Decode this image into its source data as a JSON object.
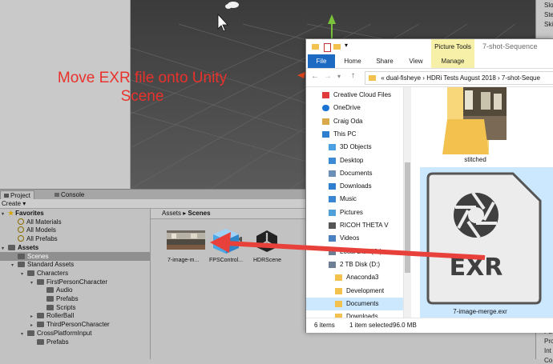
{
  "annotation": {
    "line1": "Move EXR file onto Unity",
    "line2": "Scene"
  },
  "inspector": {
    "items": [
      "Slo",
      "Ste",
      "Ski",
      "Ma",
      "Pa",
      "Pro",
      "Int",
      "Co"
    ]
  },
  "project_panel": {
    "tabs": [
      "Project",
      "Console"
    ],
    "create_label": "Create",
    "tree": [
      {
        "label": "Favorites",
        "kind": "star",
        "bold": true
      },
      {
        "label": "All Materials",
        "kind": "search"
      },
      {
        "label": "All Models",
        "kind": "search"
      },
      {
        "label": "All Prefabs",
        "kind": "search"
      },
      {
        "label": "Assets",
        "kind": "folder",
        "bold": true
      },
      {
        "label": "Scenes",
        "kind": "folder",
        "selected": true
      },
      {
        "label": "Standard Assets",
        "kind": "folder"
      },
      {
        "label": "Characters",
        "kind": "folder"
      },
      {
        "label": "FirstPersonCharacter",
        "kind": "folder"
      },
      {
        "label": "Audio",
        "kind": "folder"
      },
      {
        "label": "Prefabs",
        "kind": "folder"
      },
      {
        "label": "Scripts",
        "kind": "folder"
      },
      {
        "label": "RollerBall",
        "kind": "folder"
      },
      {
        "label": "ThirdPersonCharacter",
        "kind": "folder"
      },
      {
        "label": "CrossPlatformInput",
        "kind": "folder"
      },
      {
        "label": "Prefabs",
        "kind": "folder"
      }
    ],
    "breadcrumb": {
      "root": "Assets",
      "sep": "▸",
      "current": "Scenes"
    },
    "assets": [
      "7-image-m...",
      "FPSControl...",
      "HDRScene"
    ]
  },
  "explorer": {
    "picture_tools": "Picture Tools",
    "window_title": "7-shot-Sequence",
    "ribbon_tabs": [
      "File",
      "Home",
      "Share",
      "View",
      "Manage"
    ],
    "address": {
      "prefix": "«",
      "parts": [
        "dual-fisheye",
        "HDRi Tests August 2018",
        "7-shot-Seque"
      ]
    },
    "nav_items": [
      {
        "label": "Creative Cloud Files",
        "icon": "creative-cloud",
        "color": "#e03a3a"
      },
      {
        "label": "OneDrive",
        "icon": "onedrive",
        "color": "#1b74d4"
      },
      {
        "label": "Craig Oda",
        "icon": "user",
        "color": "#d9a84b"
      },
      {
        "label": "This PC",
        "icon": "pc",
        "color": "#2e7fcf"
      },
      {
        "label": "3D Objects",
        "icon": "3d",
        "color": "#4aa0e0"
      },
      {
        "label": "Desktop",
        "icon": "desktop",
        "color": "#3b8ad6"
      },
      {
        "label": "Documents",
        "icon": "documents",
        "color": "#6c8fb8"
      },
      {
        "label": "Downloads",
        "icon": "downloads",
        "color": "#2f7fd0"
      },
      {
        "label": "Music",
        "icon": "music",
        "color": "#3a86d4"
      },
      {
        "label": "Pictures",
        "icon": "pictures",
        "color": "#4f9fd8"
      },
      {
        "label": "RICOH THETA V",
        "icon": "camera",
        "color": "#555555"
      },
      {
        "label": "Videos",
        "icon": "videos",
        "color": "#4a7fc0"
      },
      {
        "label": "Local Disk (C:)",
        "icon": "disk",
        "color": "#6c7f95"
      },
      {
        "label": "2 TB Disk (D:)",
        "icon": "disk",
        "color": "#6c7f95"
      },
      {
        "label": "Anaconda3",
        "icon": "folder",
        "color": "#f2c14e"
      },
      {
        "label": "Development",
        "icon": "folder",
        "color": "#f2c14e"
      },
      {
        "label": "Documents",
        "icon": "folder",
        "color": "#f2c14e",
        "selected": true
      },
      {
        "label": "Downloads",
        "icon": "folder",
        "color": "#f2c14e"
      }
    ],
    "files": [
      {
        "name": "stitched",
        "type": "folder"
      },
      {
        "name": "7-image-merge.exr",
        "type": "exr",
        "badge": "EXR"
      }
    ],
    "status": {
      "items_count": "6 items",
      "selected": "1 item selected",
      "size": "96.0 MB"
    }
  }
}
